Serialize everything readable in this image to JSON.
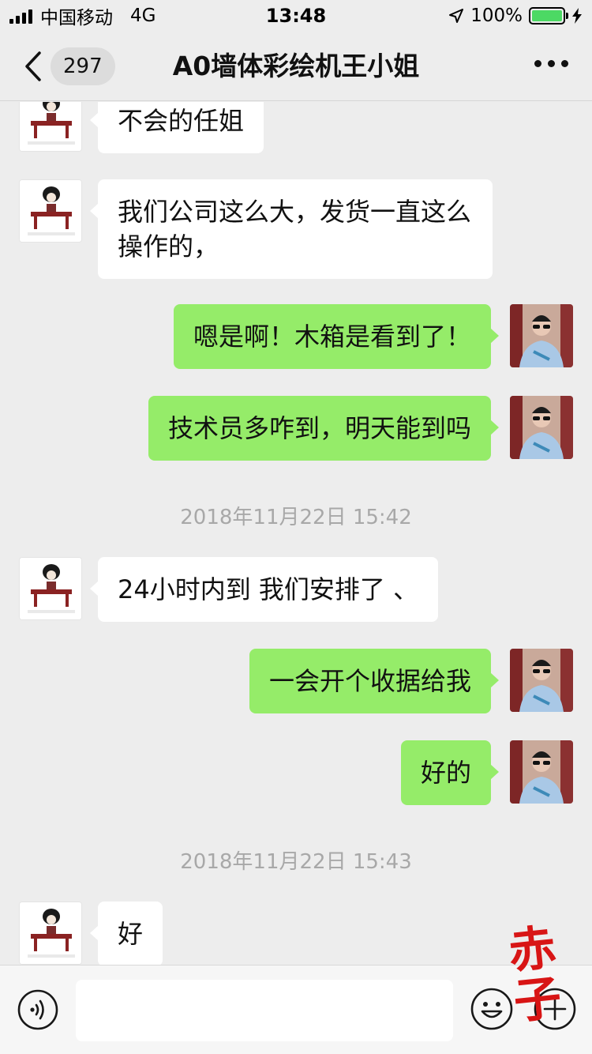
{
  "status_bar": {
    "carrier": "中国移动",
    "network": "4G",
    "time": "13:48",
    "battery_percent": "100%",
    "battery_level": 1.0,
    "colors": {
      "battery_fill": "#4cd964"
    }
  },
  "nav": {
    "back_icon": "chevron-left-icon",
    "unread_count": "297",
    "title": "A0墙体彩绘机王小姐",
    "more_icon": "more-dots-icon"
  },
  "messages": [
    {
      "side": "left",
      "text": "不会的任姐"
    },
    {
      "side": "left",
      "text": "我们公司这么大，发货一直这么操作的，"
    },
    {
      "side": "right",
      "text": "嗯是啊！木箱是看到了！"
    },
    {
      "side": "right",
      "text": "技术员多咋到，明天能到吗"
    },
    {
      "type": "time",
      "text": "2018年11月22日 15:42"
    },
    {
      "side": "left",
      "text": "24小时内到 我们安排了 、"
    },
    {
      "side": "right",
      "text": "一会开个收据给我"
    },
    {
      "side": "right",
      "text": "好的"
    },
    {
      "type": "time",
      "text": "2018年11月22日 15:43"
    },
    {
      "side": "left",
      "text": "好"
    }
  ],
  "input_bar": {
    "voice_icon": "voice-icon",
    "input_value": "",
    "emoji_icon": "emoji-icon",
    "plus_icon": "plus-icon"
  },
  "watermark": "赤子",
  "colors": {
    "background": "#ededed",
    "bubble_sent": "#95ec69",
    "bubble_received": "#ffffff",
    "timestamp": "#a8a8a8"
  }
}
